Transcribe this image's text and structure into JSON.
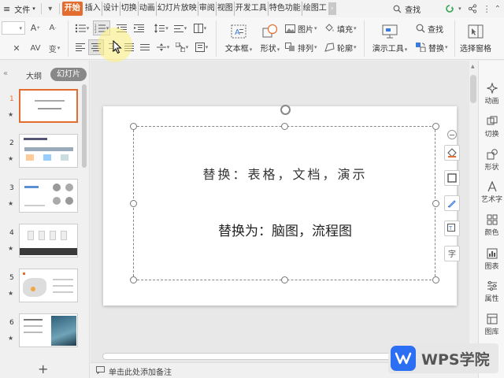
{
  "menubar": {
    "file_label": "文件",
    "tabs": [
      "开始",
      "插入",
      "设计",
      "切换",
      "动画",
      "幻灯片放映",
      "审阅",
      "视图",
      "开发工具",
      "特色功能",
      "绘图工"
    ],
    "search_label": "查找"
  },
  "ribbon": {
    "textbox_label": "文本框",
    "shape_label": "形状",
    "picture_label": "图片",
    "arrange_label": "排列",
    "fill_label": "填充",
    "outline_label": "轮廓",
    "presenter_label": "演示工具",
    "find_label": "查找",
    "replace_label": "替换",
    "selection_pane_label": "选择窗格"
  },
  "left_panel": {
    "outline_tab": "大纲",
    "slides_tab": "幻灯片",
    "slide_numbers": [
      "1",
      "2",
      "3",
      "4",
      "5",
      "6"
    ]
  },
  "slide": {
    "line1": "替换：表格，文档，演示",
    "line2": "替换为：脑图，流程图"
  },
  "right_panel": {
    "items": [
      "动画",
      "切换",
      "形状",
      "艺术字",
      "颜色",
      "图表",
      "属性",
      "图库"
    ]
  },
  "status": {
    "note_placeholder": "单击此处添加备注"
  },
  "badge": {
    "text": "WPS学院"
  },
  "colors": {
    "accent": "#e36d2e",
    "wps_blue": "#2d6ff3"
  }
}
